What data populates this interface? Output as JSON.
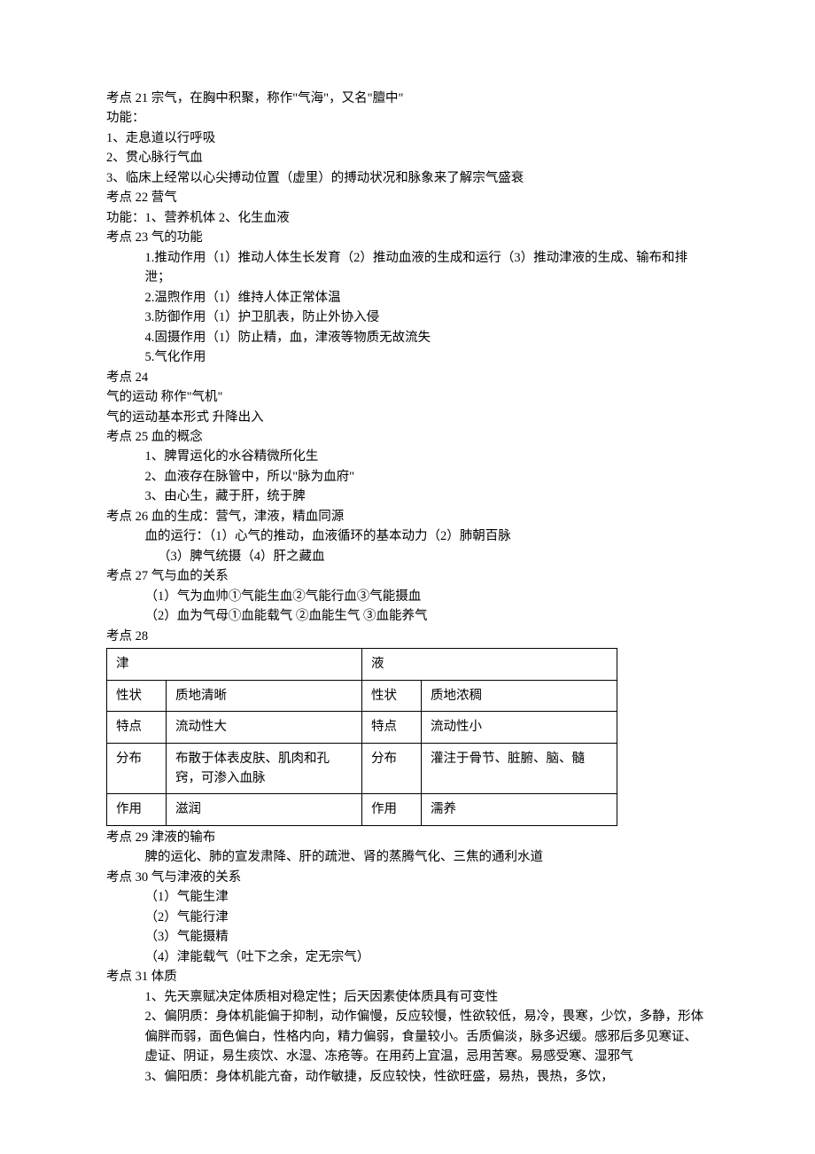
{
  "lines": {
    "l00": "考点 21 宗气，在胸中积聚，称作\"气海\"，又名\"膻中\"",
    "l01": "功能：",
    "l02": "1、走息道以行呼吸",
    "l03": "2、贯心脉行气血",
    "l04": "3、临床上经常以心尖搏动位置（虚里）的搏动状况和脉象来了解宗气盛衰",
    "l05": "考点 22  营气",
    "l06": "功能：1、营养机体 2、化生血液",
    "l07": "考点 23 气的功能",
    "l08": "1.推动作用（1）推动人体生长发育（2）推动血液的生成和运行（3）推动津液的生成、输布和排泄；",
    "l09": "2.温煦作用（1）维持人体正常体温",
    "l10": "3.防御作用（1）护卫肌表，防止外协入侵",
    "l11": "4.固摄作用（1）防止精，血，津液等物质无故流失",
    "l12": "5.气化作用",
    "l13": "考点 24",
    "l14": "气的运动      称作\"气机\"",
    "l15": "气的运动基本形式    升降出入",
    "l16": "考点 25  血的概念",
    "l17": "1、脾胃运化的水谷精微所化生",
    "l18": "2、血液存在脉管中，所以\"脉为血府\"",
    "l19": "3、由心生，藏于肝，统于脾",
    "l20": "考点 26 血的生成：营气，津液，精血同源",
    "l21": "血的运行：（1）心气的推动，血液循环的基本动力（2）肺朝百脉",
    "l22": "（3）脾气统摄（4）肝之藏血",
    "l23": "考点 27 气与血的关系",
    "l24": "（1）气为血帅①气能生血②气能行血③气能摄血",
    "l25": "（2）血为气母①血能载气 ②血能生气 ③血能养气",
    "l26": "考点 28",
    "l27": "考点 29 津液的输布",
    "l28": "脾的运化、肺的宣发肃降、肝的疏泄、肾的蒸腾气化、三焦的通利水道",
    "l29": "考点 30 气与津液的关系",
    "l30": "（1）气能生津",
    "l31": "（2）气能行津",
    "l32": "（3）气能摄精",
    "l33": "（4）津能载气（吐下之余，定无宗气）",
    "l34": "考点 31 体质",
    "l35": "1、先天禀赋决定体质相对稳定性；后天因素使体质具有可变性",
    "l36": "2、偏阴质：身体机能偏于抑制，动作偏慢，反应较慢，性欲较低，易冷，畏寒，少饮，多静，形体偏胖而弱，面色偏白，性格内向，精力偏弱，食量较小。舌质偏淡，脉多迟缓。感邪后多见寒证、虚证、阴证，易生痰饮、水湿、冻疮等。在用药上宜温，忌用苦寒。易感受寒、湿邪气",
    "l37": "3、偏阳质：身体机能亢奋，动作敏捷，反应较快，性欲旺盛，易热，畏热，多饮，"
  },
  "table": {
    "h1": "津",
    "h2": "液",
    "r1a": "性状",
    "r1b": "质地清晰",
    "r1c": "性状",
    "r1d": "质地浓稠",
    "r2a": "特点",
    "r2b": "流动性大",
    "r2c": "特点",
    "r2d": "流动性小",
    "r3a": "分布",
    "r3b": "布散于体表皮肤、肌肉和孔窍，可渗入血脉",
    "r3c": "分布",
    "r3d": "灌注于骨节、脏腑、脑、髓",
    "r4a": "作用",
    "r4b": "滋润",
    "r4c": "作用",
    "r4d": "濡养"
  }
}
